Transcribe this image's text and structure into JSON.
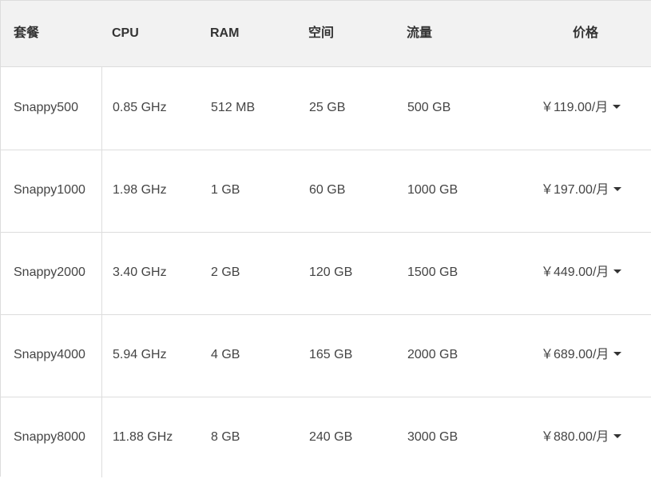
{
  "headers": {
    "plan": "套餐",
    "cpu": "CPU",
    "ram": "RAM",
    "storage": "空间",
    "traffic": "流量",
    "price": "价格"
  },
  "rows": [
    {
      "plan": "Snappy500",
      "cpu": "0.85 GHz",
      "ram": "512 MB",
      "storage": "25 GB",
      "traffic": "500 GB",
      "price": "￥119.00/月"
    },
    {
      "plan": "Snappy1000",
      "cpu": "1.98 GHz",
      "ram": "1 GB",
      "storage": "60 GB",
      "traffic": "1000 GB",
      "price": "￥197.00/月"
    },
    {
      "plan": "Snappy2000",
      "cpu": "3.40 GHz",
      "ram": "2 GB",
      "storage": "120 GB",
      "traffic": "1500 GB",
      "price": "￥449.00/月"
    },
    {
      "plan": "Snappy4000",
      "cpu": "5.94 GHz",
      "ram": "4 GB",
      "storage": "165 GB",
      "traffic": "2000 GB",
      "price": "￥689.00/月"
    },
    {
      "plan": "Snappy8000",
      "cpu": "11.88 GHz",
      "ram": "8 GB",
      "storage": "240 GB",
      "traffic": "3000 GB",
      "price": "￥880.00/月"
    }
  ],
  "colors": {
    "header_bg": "#f2f2f2",
    "border": "#dddddd",
    "text": "#444444"
  },
  "icons": {
    "price_dropdown": "caret-down-icon"
  }
}
